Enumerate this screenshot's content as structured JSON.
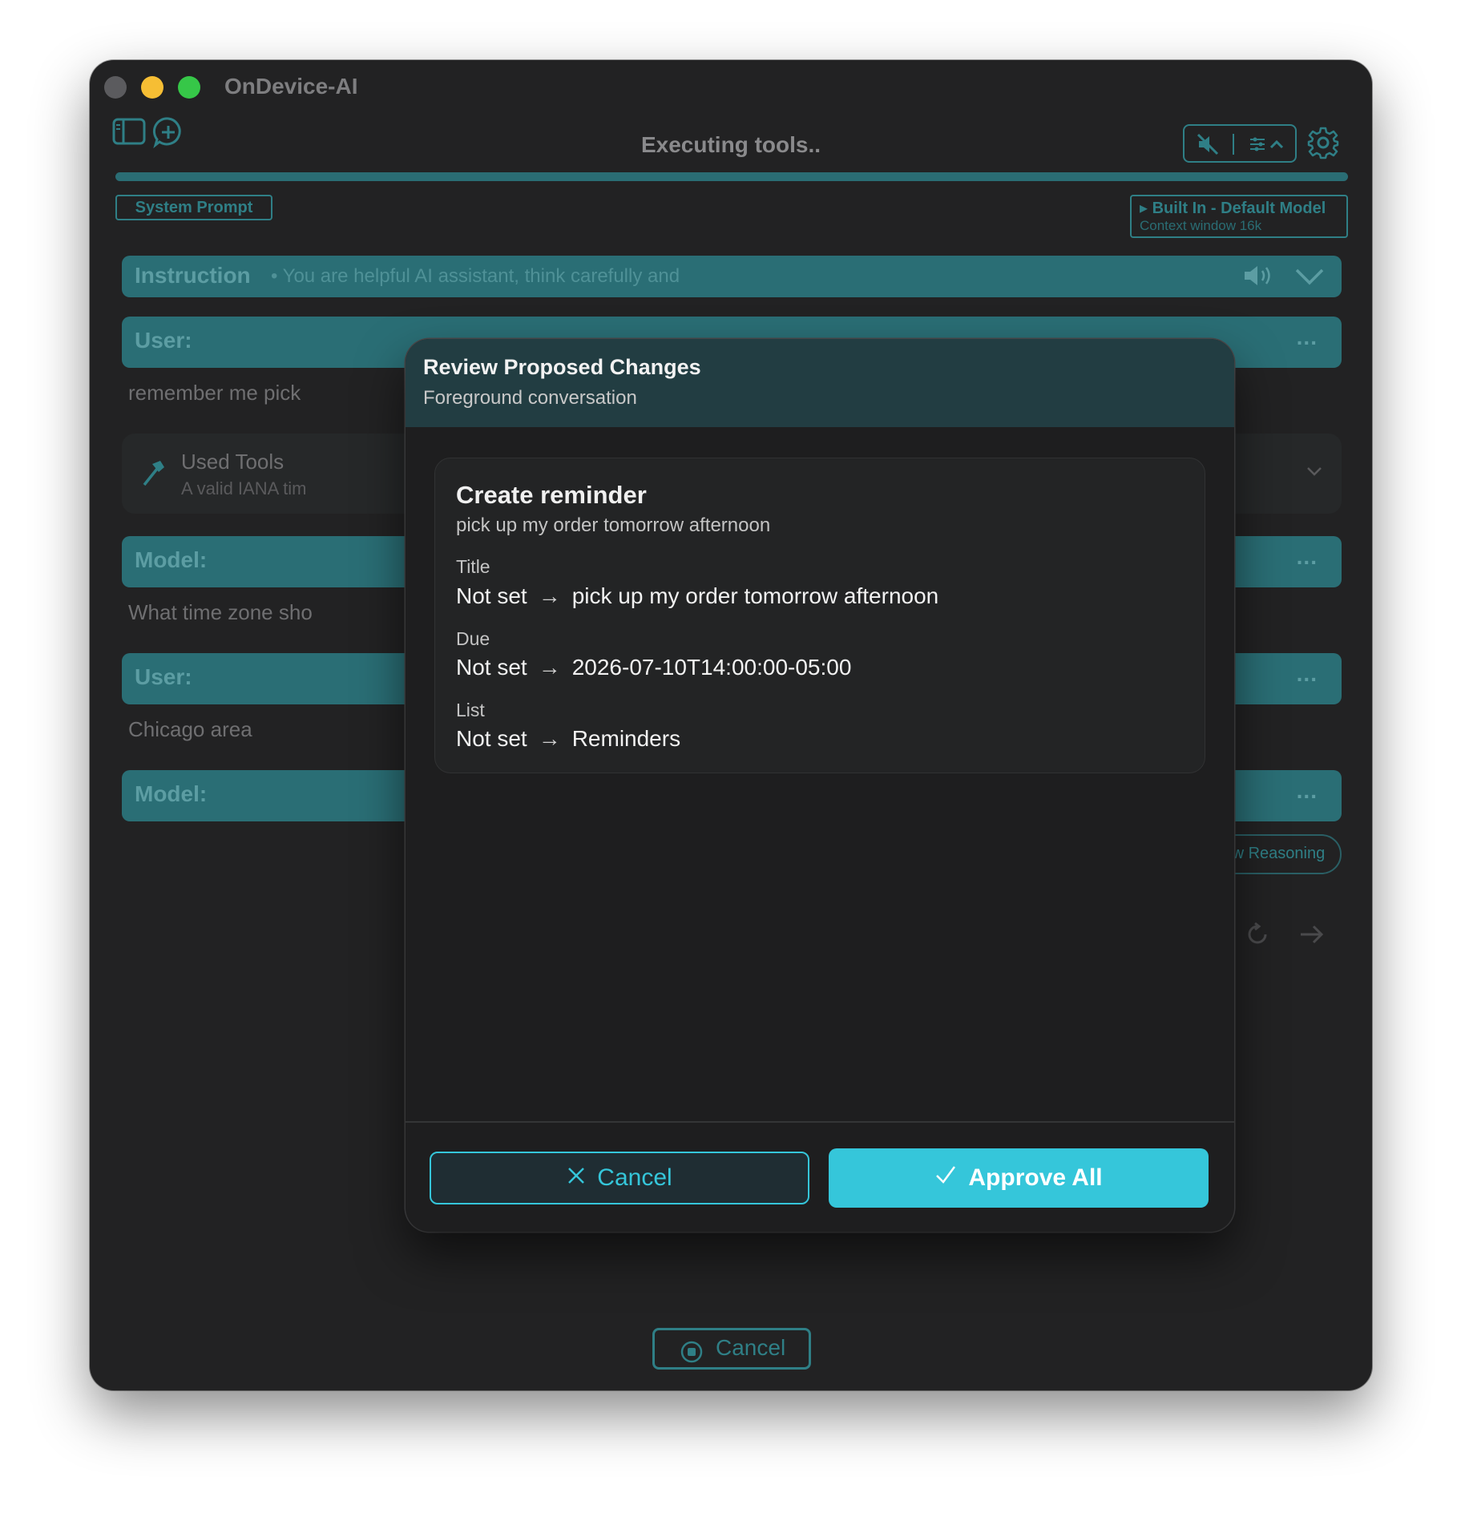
{
  "window": {
    "title": "OnDevice-AI"
  },
  "toolbar": {
    "status": "Executing tools.."
  },
  "system_prompt_label": "System Prompt",
  "model_badge": {
    "name": "▸ Built In - Default Model",
    "context": "Context window 16k"
  },
  "instruction": {
    "label": "Instruction",
    "preview": "• You are helpful AI assistant, think carefully and"
  },
  "messages": [
    {
      "role": "User:",
      "text": "remember me pick"
    },
    {
      "role": "Model:",
      "text": "What time zone sho"
    },
    {
      "role": "User:",
      "text": "Chicago area"
    },
    {
      "role": "Model:",
      "text": ""
    }
  ],
  "more_label": "...",
  "used_tools": {
    "title": "Used Tools",
    "subtitle": "A valid IANA tim"
  },
  "show_reasoning_label": "Show Reasoning",
  "bottom_cancel_label": "Cancel",
  "modal": {
    "title": "Review Proposed Changes",
    "subtitle": "Foreground conversation",
    "change": {
      "title": "Create reminder",
      "summary": "pick up my order tomorrow afternoon",
      "fields": [
        {
          "label": "Title",
          "old": "Not set",
          "new": "pick up my order tomorrow afternoon"
        },
        {
          "label": "Due",
          "old": "Not set",
          "new": "2026-07-10T14:00:00-05:00"
        },
        {
          "label": "List",
          "old": "Not set",
          "new": "Reminders"
        }
      ]
    },
    "cancel_label": "Cancel",
    "approve_label": "Approve All"
  },
  "colors": {
    "accent": "#35c6da",
    "teal_dim": "#2a6e75",
    "modal_header": "#223d42",
    "background": "#222223"
  }
}
